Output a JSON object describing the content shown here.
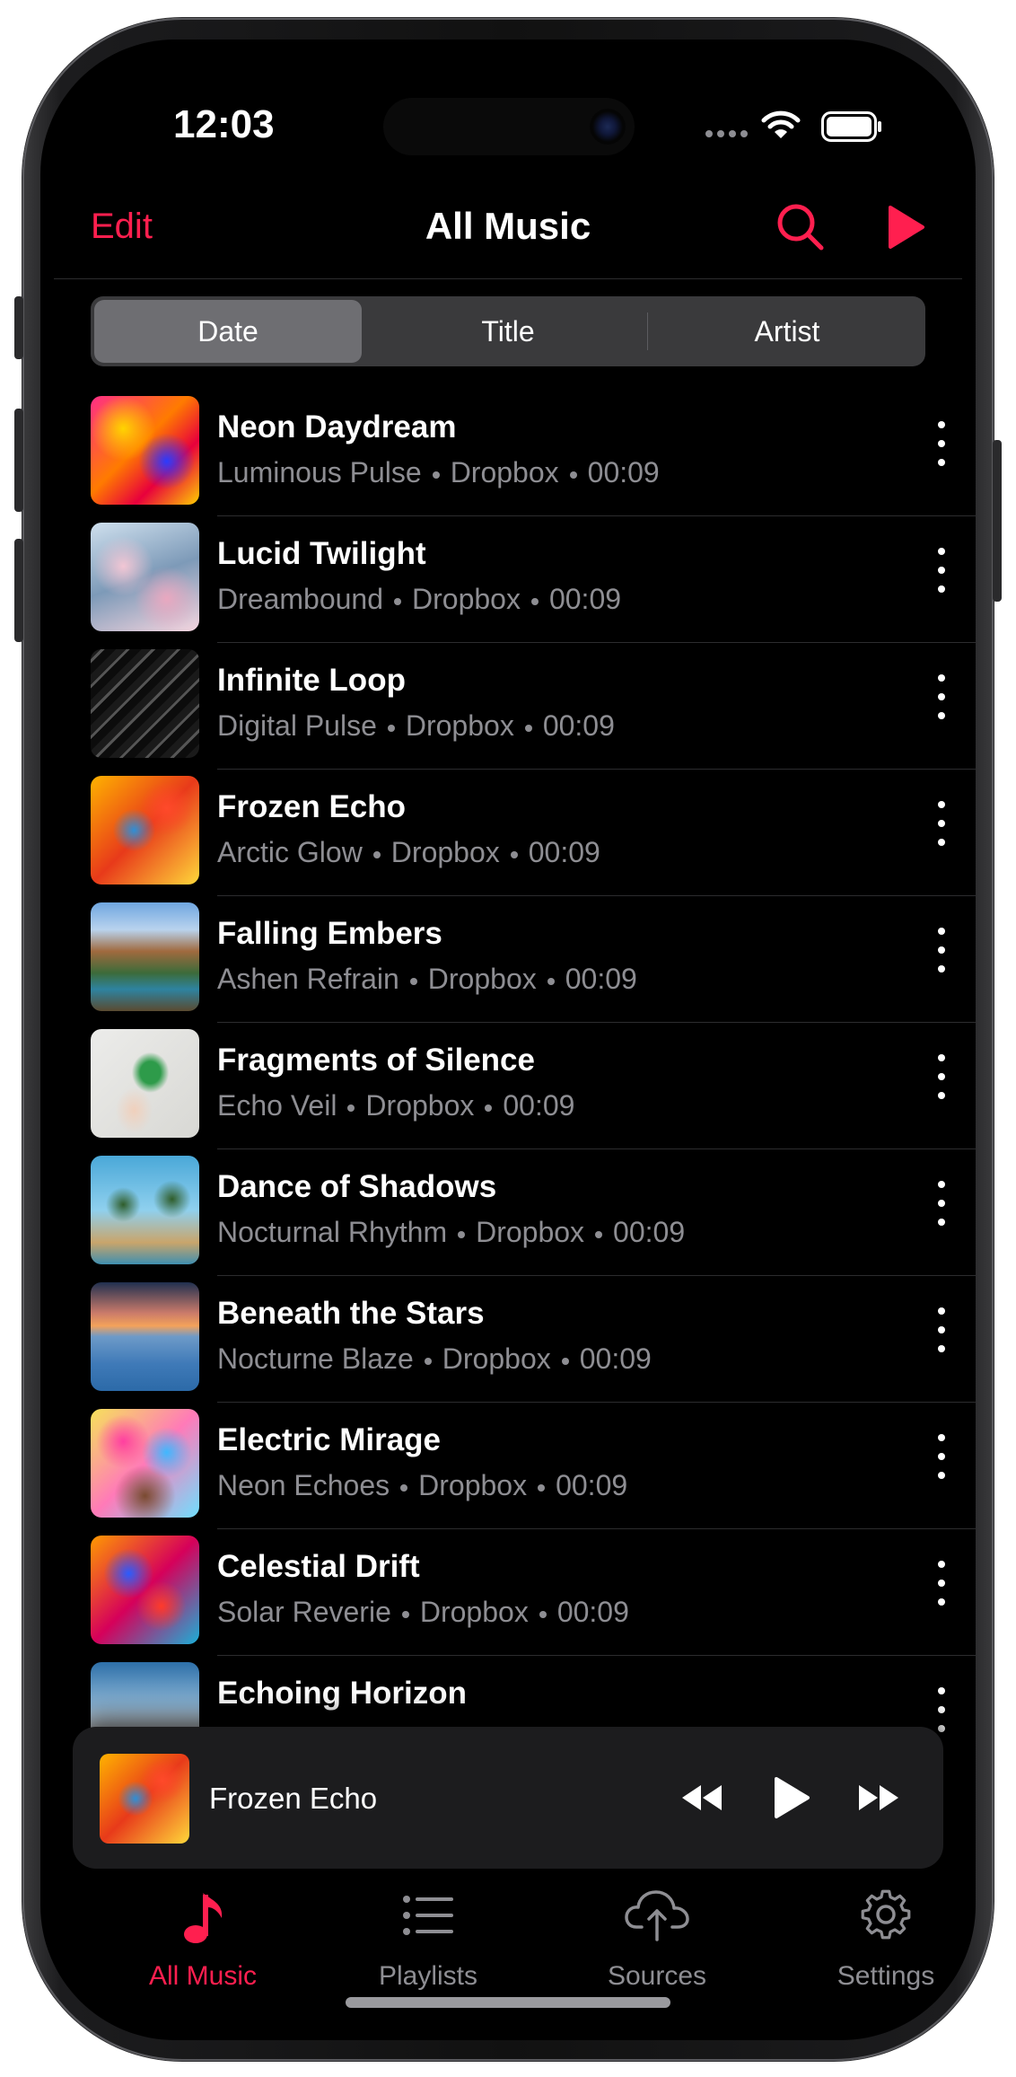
{
  "status": {
    "time": "12:03"
  },
  "nav": {
    "edit": "Edit",
    "title": "All Music"
  },
  "sort_tabs": [
    {
      "label": "Date",
      "selected": true
    },
    {
      "label": "Title",
      "selected": false
    },
    {
      "label": "Artist",
      "selected": false
    }
  ],
  "songs": [
    {
      "title": "Neon Daydream",
      "artist": "Luminous Pulse",
      "source": "Dropbox",
      "duration": "00:09",
      "art": "art-1"
    },
    {
      "title": "Lucid Twilight",
      "artist": "Dreambound",
      "source": "Dropbox",
      "duration": "00:09",
      "art": "art-2"
    },
    {
      "title": "Infinite Loop",
      "artist": "Digital Pulse",
      "source": "Dropbox",
      "duration": "00:09",
      "art": "art-3"
    },
    {
      "title": "Frozen Echo",
      "artist": "Arctic Glow",
      "source": "Dropbox",
      "duration": "00:09",
      "art": "art-4"
    },
    {
      "title": "Falling Embers",
      "artist": "Ashen Refrain",
      "source": "Dropbox",
      "duration": "00:09",
      "art": "art-5"
    },
    {
      "title": "Fragments of Silence",
      "artist": "Echo Veil",
      "source": "Dropbox",
      "duration": "00:09",
      "art": "art-6"
    },
    {
      "title": "Dance of Shadows",
      "artist": "Nocturnal Rhythm",
      "source": "Dropbox",
      "duration": "00:09",
      "art": "art-7"
    },
    {
      "title": "Beneath the Stars",
      "artist": "Nocturne Blaze",
      "source": "Dropbox",
      "duration": "00:09",
      "art": "art-8"
    },
    {
      "title": "Electric Mirage",
      "artist": "Neon Echoes",
      "source": "Dropbox",
      "duration": "00:09",
      "art": "art-9"
    },
    {
      "title": "Celestial Drift",
      "artist": "Solar Reverie",
      "source": "Dropbox",
      "duration": "00:09",
      "art": "art-10"
    },
    {
      "title": "Echoing Horizon",
      "artist": "",
      "source": "",
      "duration": "",
      "art": "art-11"
    }
  ],
  "now_playing": {
    "title": "Frozen Echo",
    "art": "art-4"
  },
  "tabs": [
    {
      "label": "All Music",
      "icon": "music-note-icon",
      "active": true
    },
    {
      "label": "Playlists",
      "icon": "list-icon",
      "active": false
    },
    {
      "label": "Sources",
      "icon": "cloud-upload-icon",
      "active": false
    },
    {
      "label": "Settings",
      "icon": "gear-icon",
      "active": false
    }
  ],
  "colors": {
    "accent": "#ff1f4f",
    "background": "#000000",
    "secondary_text": "#8e8e93",
    "segment_selected": "#6e6e72"
  }
}
